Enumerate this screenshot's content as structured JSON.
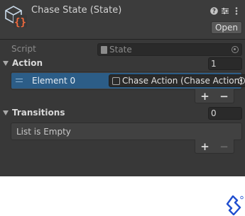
{
  "header": {
    "title": "Chase State (State)",
    "open_label": "Open",
    "icons": [
      "help-icon",
      "preset-icon",
      "more-icon"
    ]
  },
  "script_row": {
    "label": "Script",
    "value": "State"
  },
  "action": {
    "label": "Action",
    "count": "1",
    "elements": [
      {
        "label": "Element 0",
        "value": "Chase Action (Chase Action)"
      }
    ]
  },
  "transitions": {
    "label": "Transitions",
    "count": "0",
    "empty_text": "List is Empty"
  },
  "list_buttons": {
    "add": "+",
    "remove": "−"
  },
  "colors": {
    "inspector_bg": "#383838",
    "selected_row": "#2c5d87",
    "toptal_logo": "#204ecf"
  }
}
